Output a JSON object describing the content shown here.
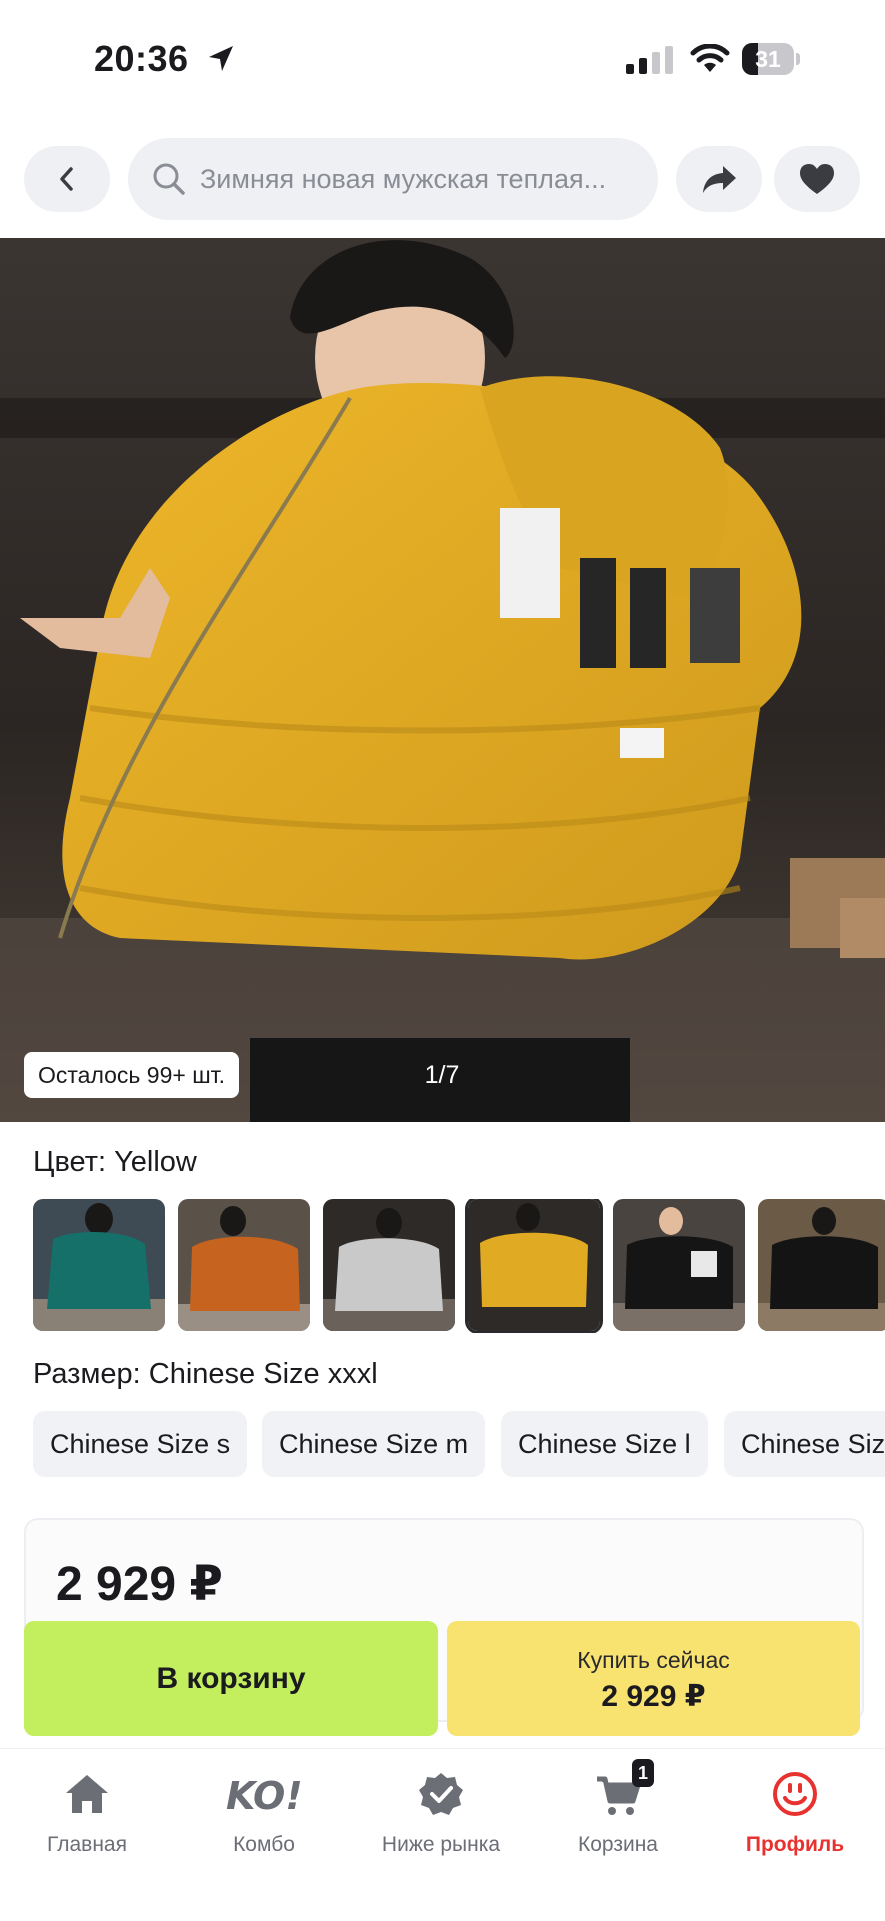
{
  "status_bar": {
    "time": "20:36",
    "battery": "31",
    "battery_level": 0.31
  },
  "header": {
    "search_text": "Зимняя новая мужская теплая...",
    "icons": [
      "back-icon",
      "search-icon",
      "share-icon",
      "heart-icon"
    ]
  },
  "gallery": {
    "stock_label": "Осталось 99+ шт.",
    "counter": "1/7"
  },
  "color": {
    "label": "Цвет: Yellow",
    "swatches": [
      "Teal",
      "Orange",
      "Gray",
      "Yellow",
      "Black",
      "Black"
    ],
    "selected_index": 3
  },
  "size": {
    "label": "Размер: Chinese Size xxxl",
    "options": [
      "Chinese Size s",
      "Chinese Size m",
      "Chinese Size l",
      "Chinese Size xl"
    ]
  },
  "price": {
    "amount": "2 929 ₽"
  },
  "actions": {
    "cart_label": "В корзину",
    "buy_label": "Купить сейчас",
    "buy_price": "2 929 ₽"
  },
  "nav": {
    "items": [
      {
        "label": "Главная",
        "icon": "home-icon"
      },
      {
        "label": "Комбо",
        "icon": "ko-logo-icon"
      },
      {
        "label": "Ниже рынка",
        "icon": "badge-check-icon"
      },
      {
        "label": "Корзина",
        "icon": "cart-icon"
      },
      {
        "label": "Профиль",
        "icon": "smile-icon"
      }
    ],
    "cart_badge": "1",
    "active_index": 4
  },
  "colors": {
    "accent": "#e8322f",
    "cart_button": "#c3ef5e",
    "buy_button": "#f8e371",
    "jacket": "#e0aa22"
  }
}
